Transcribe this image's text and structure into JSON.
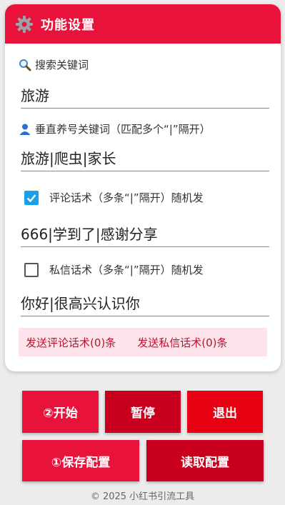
{
  "header": {
    "title": "功能设置",
    "icon": "gear-icon"
  },
  "search": {
    "label": "搜索关键词",
    "icon": "search-icon",
    "value": "旅游"
  },
  "vertical": {
    "label": "垂直养号关键词（匹配多个“|”隔开）",
    "icon": "user-icon",
    "value": "旅游|爬虫|家长"
  },
  "comment": {
    "checked": true,
    "label": "评论话术（多条“|”隔开）随机发",
    "value": "666|学到了|感谢分享"
  },
  "dm": {
    "checked": false,
    "label": "私信话术（多条“|”隔开）随机发",
    "value": "你好|很高兴认识你"
  },
  "stats": {
    "comment_sent": "发送评论话术(0)条",
    "dm_sent": "发送私信话术(0)条"
  },
  "buttons": {
    "start": "②开始",
    "pause": "暂停",
    "exit": "退出",
    "save": "①保存配置",
    "load": "读取配置"
  },
  "footer": "© 2025 小红书引流工具",
  "colors": {
    "accent": "#e8123a",
    "dark_red": "#c8001e",
    "checkbox": "#1aa0e8"
  }
}
